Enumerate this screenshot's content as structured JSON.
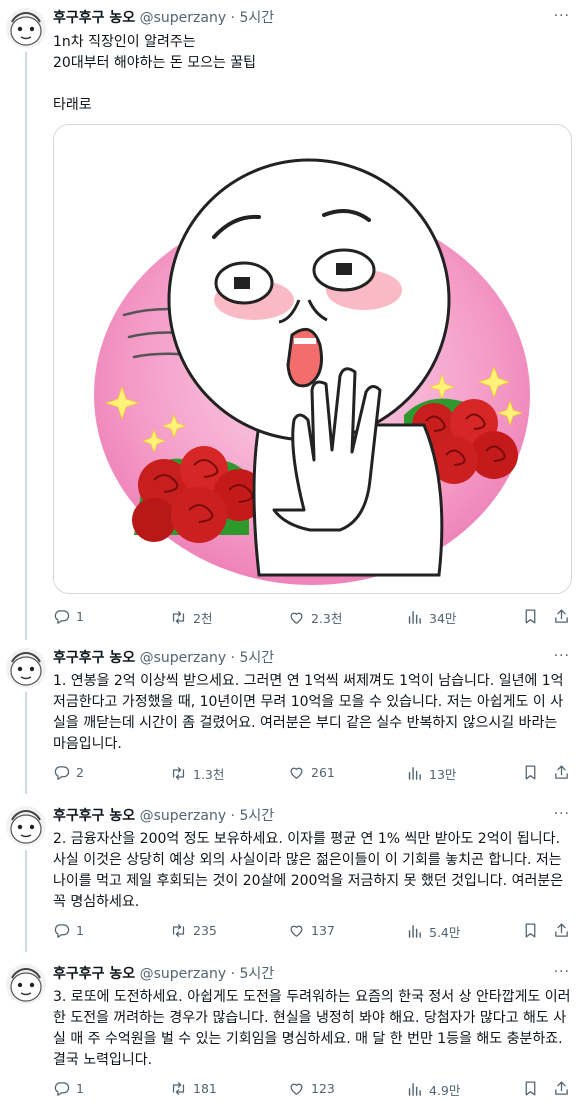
{
  "tweets": [
    {
      "name": "후구후구 농오",
      "handle": "@superzany",
      "dot": "·",
      "time": "5시간",
      "lines": [
        "1n차 직장인이 알려주는",
        "20대부터 해야하는 돈 모으는 꿀팁",
        "",
        "타래로"
      ],
      "stats": {
        "reply": "1",
        "retweet": "2천",
        "like": "2.3천",
        "views": "34만"
      }
    },
    {
      "name": "후구후구 농오",
      "handle": "@superzany",
      "dot": "·",
      "time": "5시간",
      "text": "1. 연봉을 2억 이상씩 받으세요. 그러면 연 1억씩 써제껴도 1억이 남습니다. 일년에 1억 저금한다고 가정했을 때, 10년이면 무려 10억을 모을 수 있습니다. 저는 아쉽게도 이 사실을 깨닫는데 시간이 좀 걸렸어요. 여러분은 부디 같은 실수 반복하지 않으시길 바라는 마음입니다.",
      "stats": {
        "reply": "2",
        "retweet": "1.3천",
        "like": "261",
        "views": "13만"
      }
    },
    {
      "name": "후구후구 농오",
      "handle": "@superzany",
      "dot": "·",
      "time": "5시간",
      "text": "2. 금융자산을 200억 정도 보유하세요. 이자를 평균 연 1% 씩만 받아도 2억이 됩니다. 사실 이것은 상당히 예상 외의 사실이라 많은 젊은이들이 이 기회를 놓치곤 합니다. 저는 나이를 먹고 제일 후회되는 것이 20살에 200억을 저금하지 못 했던 것입니다. 여러분은 꼭 명심하세요.",
      "stats": {
        "reply": "1",
        "retweet": "235",
        "like": "137",
        "views": "5.4만"
      }
    },
    {
      "name": "후구후구 농오",
      "handle": "@superzany",
      "dot": "·",
      "time": "5시간",
      "text": "3. 로또에 도전하세요. 아쉽게도 도전을 두려워하는 요즘의 한국 정서 상 안타깝게도 이러한 도전을 꺼려하는 경우가 많습니다. 현실을 냉정히 봐야 해요. 당첨자가 많다고 해도 사실 매 주 수억원을 벌 수 있는 기회임을 명심하세요. 매 달 한 번만 1등을 해도 충분하죠. 결국 노력입니다.",
      "stats": {
        "reply": "1",
        "retweet": "181",
        "like": "123",
        "views": "4.9만"
      }
    }
  ],
  "more_label": "···",
  "icons": [
    "reply-icon",
    "retweet-icon",
    "like-icon",
    "views-icon",
    "bookmark-icon",
    "share-icon"
  ]
}
